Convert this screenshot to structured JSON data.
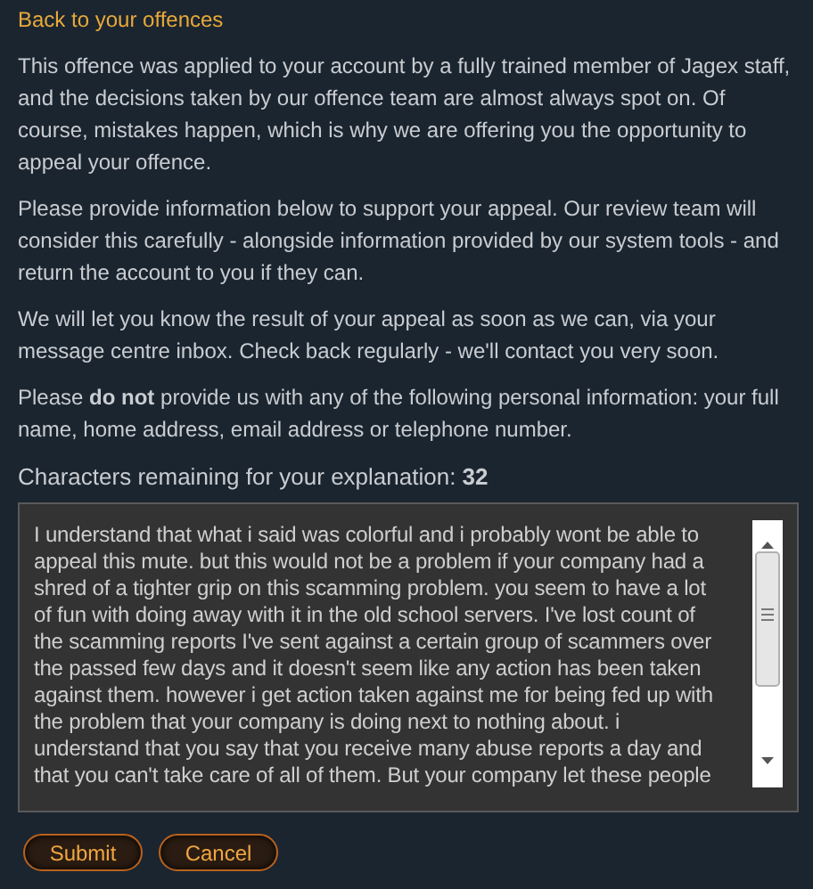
{
  "back_link": "Back to your offences",
  "paragraphs": [
    "This offence was applied to your account by a fully trained member of Jagex staff, and the decisions taken by our offence team are almost always spot on. Of course, mistakes happen, which is why we are offering you the opportunity to appeal your offence.",
    "Please provide information below to support your appeal. Our review team will consider this carefully - alongside information provided by our system tools - and return the account to you if they can.",
    "We will let you know the result of your appeal as soon as we can, via your message centre inbox. Check back regularly - we'll contact you very soon.",
    "Please **do not** provide us with any of the following personal information: your full name, home address, email address or telephone number."
  ],
  "counter": "Characters remaining for your explanation: **32**",
  "explanation_lines": [
    "I understand that what i said was colorful and i probably wont be able to",
    "appeal this mute. but this would not be a problem if your company had a",
    "shred of a tighter grip on this scamming problem. you seem to have a lot",
    "of fun with doing away with it in the old school servers. I've lost count of",
    "the scamming reports I've sent against a certain group of scammers over",
    "the passed few days and it doesn't seem like any action has been taken",
    "against them. however i get action taken against me for being fed up with",
    "the problem that your company is doing next to nothing about. i",
    "understand that you say that you receive many abuse reports a day and",
    "that you can't take care of all of them. But your company let these people"
  ],
  "buttons": [
    "Submit",
    "Cancel"
  ]
}
